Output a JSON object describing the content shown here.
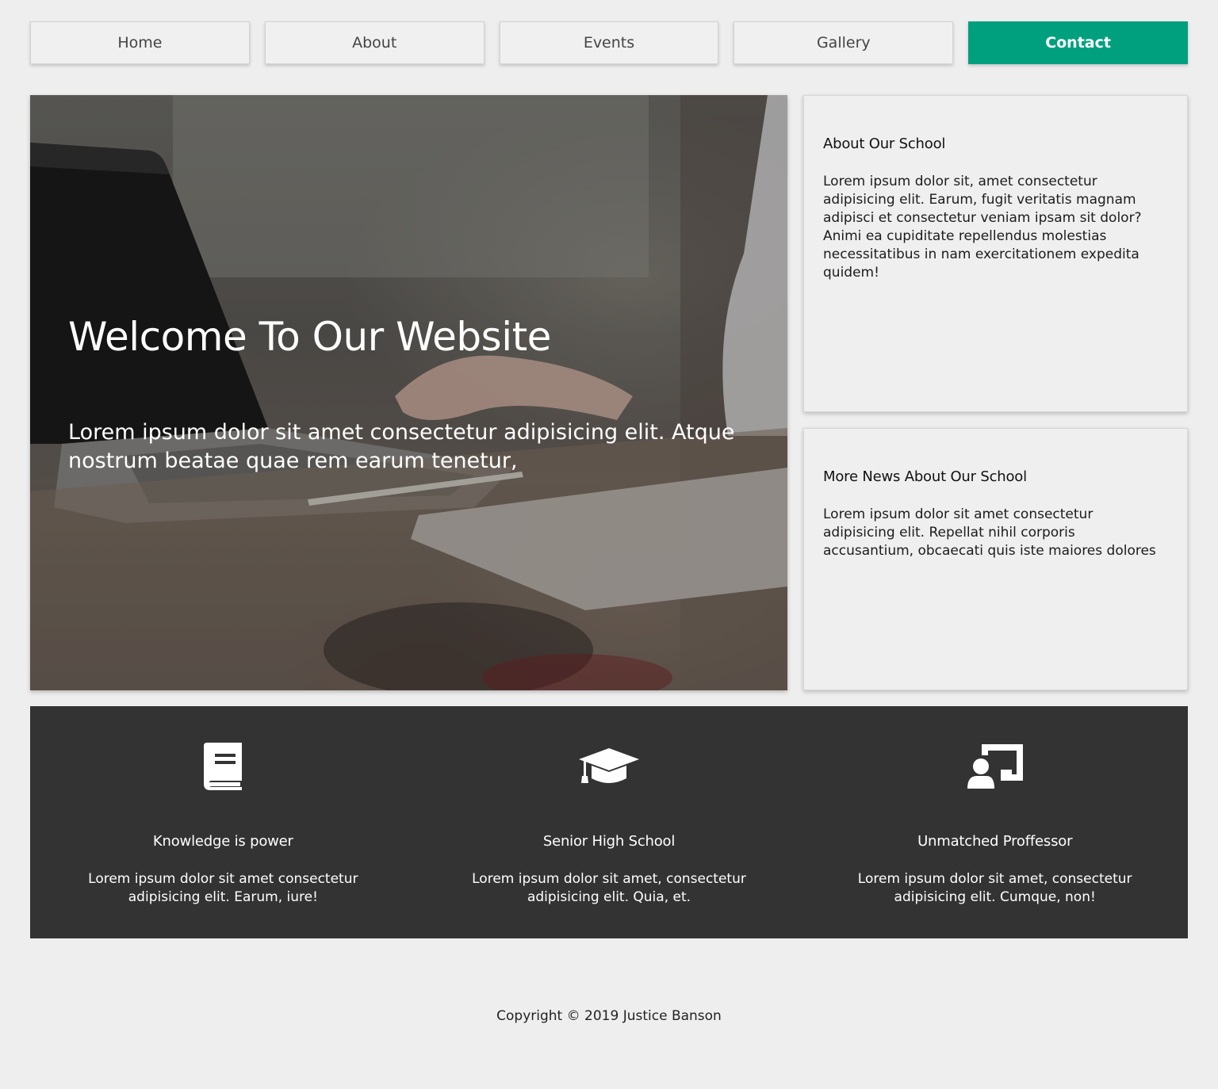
{
  "nav": {
    "items": [
      {
        "label": "Home",
        "active": false
      },
      {
        "label": "About",
        "active": false
      },
      {
        "label": "Events",
        "active": false
      },
      {
        "label": "Gallery",
        "active": false
      },
      {
        "label": "Contact",
        "active": true
      }
    ],
    "active_color": "#00a07f"
  },
  "hero": {
    "title": "Welcome To Our Website",
    "text": "Lorem ipsum dolor sit amet consectetur adipisicing elit. Atque nostrum beatae quae rem earum tenetur,"
  },
  "cards": [
    {
      "title": "About Our School",
      "text": "Lorem ipsum dolor sit, amet consectetur adipisicing elit. Earum, fugit veritatis magnam adipisci et consectetur veniam ipsam sit dolor? Animi ea cupiditate repellendus molestias necessitatibus in nam exercitationem expedita quidem!"
    },
    {
      "title": "More News About Our School",
      "text": "Lorem ipsum dolor sit amet consectetur adipisicing elit. Repellat nihil corporis accusantium, obcaecati quis iste maiores dolores"
    }
  ],
  "features": [
    {
      "icon": "book-icon",
      "title": "Knowledge is power",
      "text": "Lorem ipsum dolor sit amet consectetur adipisicing elit. Earum, iure!"
    },
    {
      "icon": "graduation-cap-icon",
      "title": "Senior High School",
      "text": "Lorem ipsum dolor sit amet, consectetur adipisicing elit. Quia, et."
    },
    {
      "icon": "chalkboard-teacher-icon",
      "title": "Unmatched Proffessor",
      "text": "Lorem ipsum dolor sit amet, consectetur adipisicing elit. Cumque, non!"
    }
  ],
  "footer": {
    "copyright": "Copyright © 2019 Justice Banson"
  },
  "colors": {
    "background": "#eeeeee",
    "band": "#333333",
    "accent": "#00a07f"
  }
}
